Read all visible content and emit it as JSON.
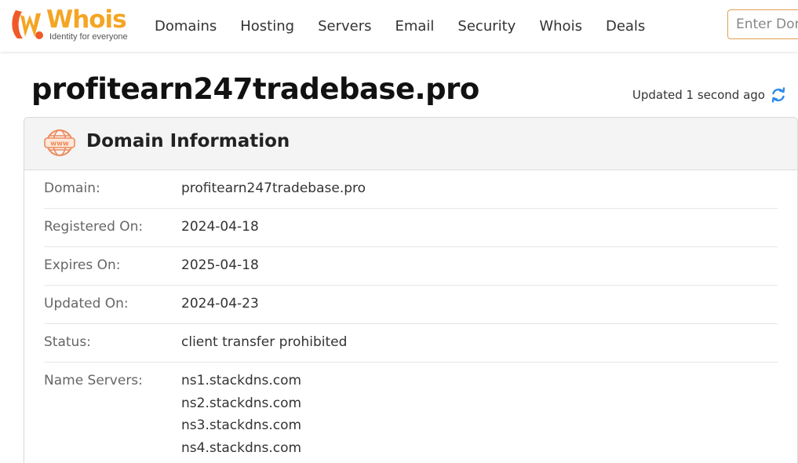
{
  "brand": {
    "name": "Whois",
    "tagline": "Identity for everyone",
    "accent_color": "#f4a524",
    "mark_color": "#f05a28"
  },
  "nav": {
    "items": [
      "Domains",
      "Hosting",
      "Servers",
      "Email",
      "Security",
      "Whois",
      "Deals"
    ]
  },
  "search": {
    "placeholder": "Enter Domain"
  },
  "page": {
    "title": "profitearn247tradebase.pro",
    "updated_text": "Updated 1 second ago"
  },
  "card": {
    "title": "Domain Information",
    "icon": "www-globe-icon",
    "rows": [
      {
        "label": "Domain:",
        "value": "profitearn247tradebase.pro"
      },
      {
        "label": "Registered On:",
        "value": "2024-04-18"
      },
      {
        "label": "Expires On:",
        "value": "2025-04-18"
      },
      {
        "label": "Updated On:",
        "value": "2024-04-23"
      },
      {
        "label": "Status:",
        "value": "client transfer prohibited"
      },
      {
        "label": "Name Servers:",
        "values": [
          "ns1.stackdns.com",
          "ns2.stackdns.com",
          "ns3.stackdns.com",
          "ns4.stackdns.com"
        ]
      }
    ]
  }
}
